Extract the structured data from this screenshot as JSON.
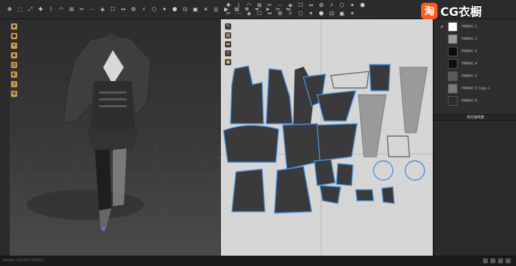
{
  "toolbar_left": {
    "icons": [
      "move-tool",
      "select-tool",
      "transform-tool",
      "pin-tool",
      "sewing-tool",
      "fold-tool",
      "measure-tool",
      "pattern-tool",
      "point-tool",
      "brush-tool",
      "texture-tool",
      "tape-tool",
      "button-tool",
      "zip-tool",
      "avatar-tool",
      "sim-tool",
      "gravity-tool",
      "fabric-tool",
      "grid-tool",
      "light-tool",
      "camera-tool",
      "render-tool",
      "lock-tool",
      "freeze-tool",
      "pen-tool",
      "arrow-tool",
      "cut-tool",
      "mirror-tool"
    ]
  },
  "toolbar_right": {
    "icons": [
      "select-pattern",
      "edit-pattern",
      "transform-pattern",
      "point-add",
      "curve-point",
      "polygon",
      "rectangle",
      "circle",
      "internal-polygon",
      "dart",
      "seam",
      "segment-sew",
      "free-sew",
      "fold",
      "tack",
      "mesh",
      "trace",
      "notch",
      "grain",
      "symmetry",
      "unfold",
      "baseline",
      "measure",
      "ruler",
      "texture-edit",
      "arrange",
      "topstitch"
    ]
  },
  "fabrics": [
    {
      "name": "FABRIC 1",
      "color": "#ffffff",
      "checked": true
    },
    {
      "name": "FABRIC 2",
      "color": "#9a9a9a",
      "checked": false
    },
    {
      "name": "FABRIC 3",
      "color": "#0a0a0a",
      "checked": false
    },
    {
      "name": "FABRIC 4",
      "color": "#0d0d0d",
      "checked": false
    },
    {
      "name": "FABRIC 5",
      "color": "#5a5a5a",
      "checked": false
    },
    {
      "name": "FABRIC 5 Copy 1",
      "color": "#7a7a7a",
      "checked": false
    },
    {
      "name": "FABRIC 6",
      "color": "#2c2c2c",
      "checked": false
    }
  ],
  "property_panel": {
    "title": "属性编辑器"
  },
  "status_bar": {
    "text": "Version 4.2.123 (r4312)"
  },
  "watermark": {
    "logo": "淘",
    "text": "CG衣橱"
  },
  "colors": {
    "accent_blue": "#4a90d9",
    "pattern_fill": "#3a3a3c",
    "grid_bg": "#d6d6d6"
  }
}
